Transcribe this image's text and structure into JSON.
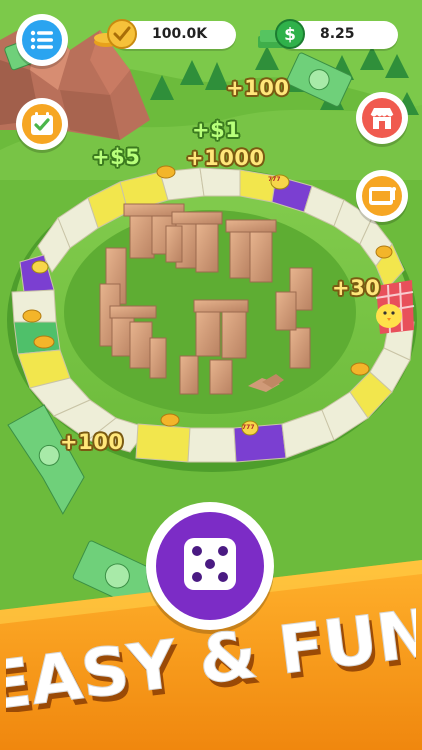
{
  "hud": {
    "coins_value": "100.0K",
    "cash_value": "8.25"
  },
  "buttons": {
    "menu_icon": "list-icon",
    "tasks_icon": "checklist-icon",
    "shop_icon": "shop-icon",
    "slot_icon": "slot-machine-icon",
    "dice_icon": "dice-icon"
  },
  "rewards": {
    "r1": "+100",
    "r2": "+$1",
    "r3": "+$5",
    "r4": "+1000",
    "r5": "+30",
    "r6": "+100"
  },
  "slot_label": "777",
  "banner": {
    "title": "EASY & FUN"
  },
  "colors": {
    "grass": "#6fbf3f",
    "banner": "#f39a1a",
    "dice_button": "#7c2cc6",
    "shop_button": "#f05a4f",
    "menu_button": "#2aa4f0",
    "tasks_button": "#f6a623",
    "slot_button": "#f6a623"
  }
}
